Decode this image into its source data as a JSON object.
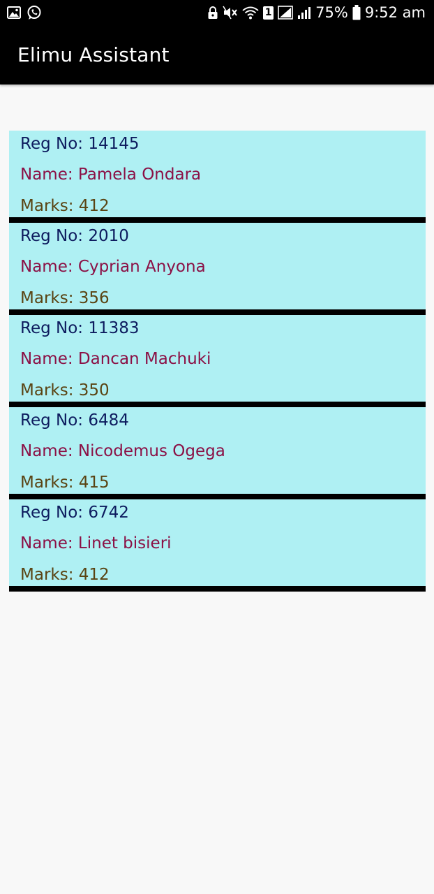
{
  "status_bar": {
    "battery_percent": "75%",
    "time": "9:52 am",
    "sim_slot": "1",
    "icons": [
      "image-icon",
      "whatsapp-icon",
      "lock-icon",
      "mute-icon",
      "wifi-icon",
      "sim-icon",
      "signal-icon",
      "signal-icon",
      "battery-icon"
    ]
  },
  "app_bar": {
    "title": "Elimu Assistant"
  },
  "students": [
    {
      "reg": "Reg No: 14145",
      "name": "Name: Pamela Ondara",
      "marks": "Marks: 412"
    },
    {
      "reg": "Reg No: 2010",
      "name": "Name: Cyprian Anyona",
      "marks": "Marks: 356"
    },
    {
      "reg": "Reg No: 11383",
      "name": "Name: Dancan Machuki",
      "marks": "Marks: 350"
    },
    {
      "reg": "Reg No: 6484",
      "name": "Name: Nicodemus Ogega",
      "marks": "Marks: 415"
    },
    {
      "reg": "Reg No: 6742",
      "name": "Name: Linet bisieri",
      "marks": "Marks: 412"
    }
  ],
  "colors": {
    "card_background": "#aff0f3",
    "reg_text": "#0d1b5e",
    "name_text": "#8b1045",
    "marks_text": "#5a4413",
    "app_bar": "#000000"
  }
}
